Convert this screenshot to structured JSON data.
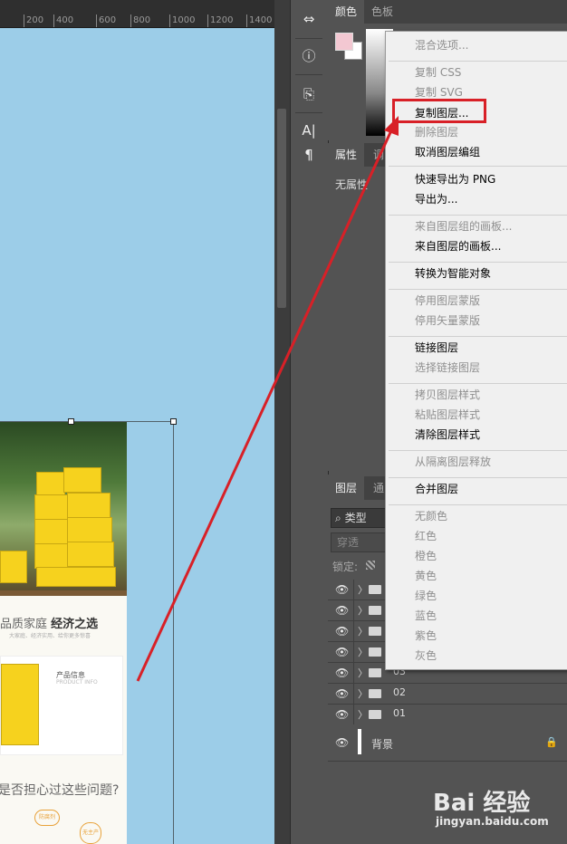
{
  "ruler": {
    "labels": [
      "200",
      "400",
      "600",
      "800",
      "1000",
      "1200",
      "1400"
    ]
  },
  "toolbar": {
    "icons": [
      "paragraph-styles-icon",
      "info-icon",
      "glyphs-icon",
      "character-icon",
      "paragraph-icon"
    ],
    "glyphs": {
      "paragraph_styles": "⇔",
      "info": "ⓘ",
      "glyphs": "⎘",
      "character": "A|",
      "paragraph": "¶"
    }
  },
  "color_panel": {
    "tabs": [
      "颜色",
      "色板"
    ],
    "foreground": "#f3c8d2",
    "background": "#ffffff"
  },
  "properties_panel": {
    "tabs": [
      "属性",
      "调"
    ],
    "content": "无属性"
  },
  "layers_panel": {
    "tabs": [
      "图层",
      "通"
    ],
    "filter_label": "类型",
    "blend_mode": "穿透",
    "lock_label": "锁定:",
    "layers": [
      "",
      "",
      "",
      "",
      "03",
      "02",
      "01"
    ],
    "background_layer": "背景"
  },
  "context_menu": {
    "highlight_color": "#d82027",
    "items": [
      {
        "label": "混合选项...",
        "enabled": false
      },
      {
        "label": "复制 CSS",
        "enabled": false
      },
      {
        "label": "复制 SVG",
        "enabled": false
      },
      {
        "label": "复制图层...",
        "enabled": true
      },
      {
        "label": "删除图层",
        "enabled": false
      },
      {
        "label": "取消图层编组",
        "enabled": true
      },
      {
        "label": "快速导出为 PNG",
        "enabled": true
      },
      {
        "label": "导出为...",
        "enabled": true
      },
      {
        "label": "来自图层组的画板...",
        "enabled": false
      },
      {
        "label": "来自图层的画板...",
        "enabled": true
      },
      {
        "label": "转换为智能对象",
        "enabled": true
      },
      {
        "label": "停用图层蒙版",
        "enabled": false
      },
      {
        "label": "停用矢量蒙版",
        "enabled": false
      },
      {
        "label": "链接图层",
        "enabled": true
      },
      {
        "label": "选择链接图层",
        "enabled": false
      },
      {
        "label": "拷贝图层样式",
        "enabled": false
      },
      {
        "label": "粘贴图层样式",
        "enabled": false
      },
      {
        "label": "清除图层样式",
        "enabled": true
      },
      {
        "label": "从隔离图层释放",
        "enabled": false
      },
      {
        "label": "合并图层",
        "enabled": true
      },
      {
        "label": "无颜色",
        "enabled": false
      },
      {
        "label": "红色",
        "enabled": false
      },
      {
        "label": "橙色",
        "enabled": false
      },
      {
        "label": "黄色",
        "enabled": false
      },
      {
        "label": "绿色",
        "enabled": false
      },
      {
        "label": "蓝色",
        "enabled": false
      },
      {
        "label": "紫色",
        "enabled": false
      },
      {
        "label": "灰色",
        "enabled": false
      }
    ]
  },
  "artwork": {
    "headline_light": "品质家庭",
    "headline_bold": "经济之选",
    "subline": "大家庭、经济实用、给你更多惊喜",
    "card_title": "产品信息",
    "card_subtitle": "PRODUCT INFO",
    "question": "是否担心过这些问题?",
    "badge1": "防腐剂",
    "badge2": "无主产品"
  },
  "watermark": {
    "logo": "Bai 经验",
    "url": "jingyan.baidu.com"
  }
}
